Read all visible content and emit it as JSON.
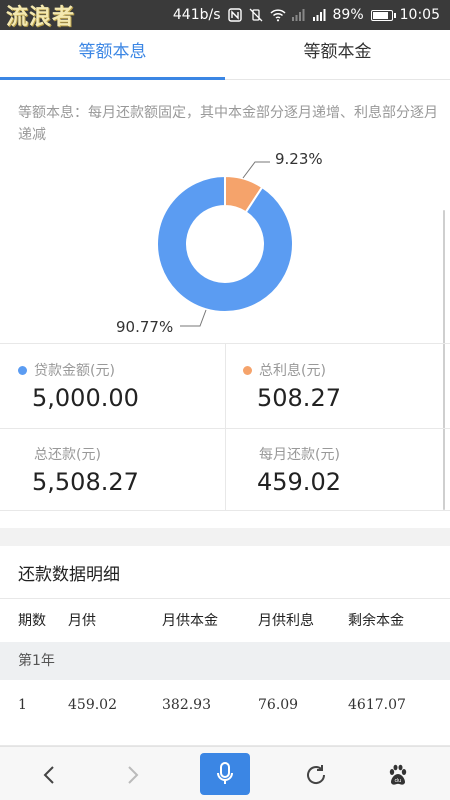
{
  "status_bar": {
    "watermark": "流浪者",
    "network_speed": "441b/s",
    "battery": "89%",
    "battery_level": 0.89,
    "time": "10:05"
  },
  "tabs": [
    {
      "label": "等额本息",
      "active": true
    },
    {
      "label": "等额本金",
      "active": false
    }
  ],
  "description": "等额本息：每月还款额固定，其中本金部分逐月递增、利息部分逐月递减",
  "chart_data": {
    "type": "pie",
    "donut": true,
    "slices": [
      {
        "name": "贷款金额(元)",
        "value": 90.77,
        "label": "90.77%",
        "color": "#5b9cf2"
      },
      {
        "name": "总利息(元)",
        "value": 9.23,
        "label": "9.23%",
        "color": "#f5a36b"
      }
    ]
  },
  "stats": {
    "loan_amount": {
      "label": "贷款金额(元)",
      "value": "5,000.00",
      "color": "#5b9cf2"
    },
    "total_interest": {
      "label": "总利息(元)",
      "value": "508.27",
      "color": "#f5a36b"
    },
    "total_repayment": {
      "label": "总还款(元)",
      "value": "5,508.27"
    },
    "monthly_payment": {
      "label": "每月还款(元)",
      "value": "459.02"
    }
  },
  "detail": {
    "title": "还款数据明细",
    "columns": [
      "期数",
      "月供",
      "月供本金",
      "月供利息",
      "剩余本金"
    ],
    "year_label": "第1年",
    "rows": [
      [
        "1",
        "459.02",
        "382.93",
        "76.09",
        "4617.07"
      ]
    ]
  },
  "toolbar": {
    "icons": [
      "back-icon",
      "forward-icon",
      "microphone-icon",
      "refresh-icon",
      "baidu-paw-icon"
    ]
  }
}
